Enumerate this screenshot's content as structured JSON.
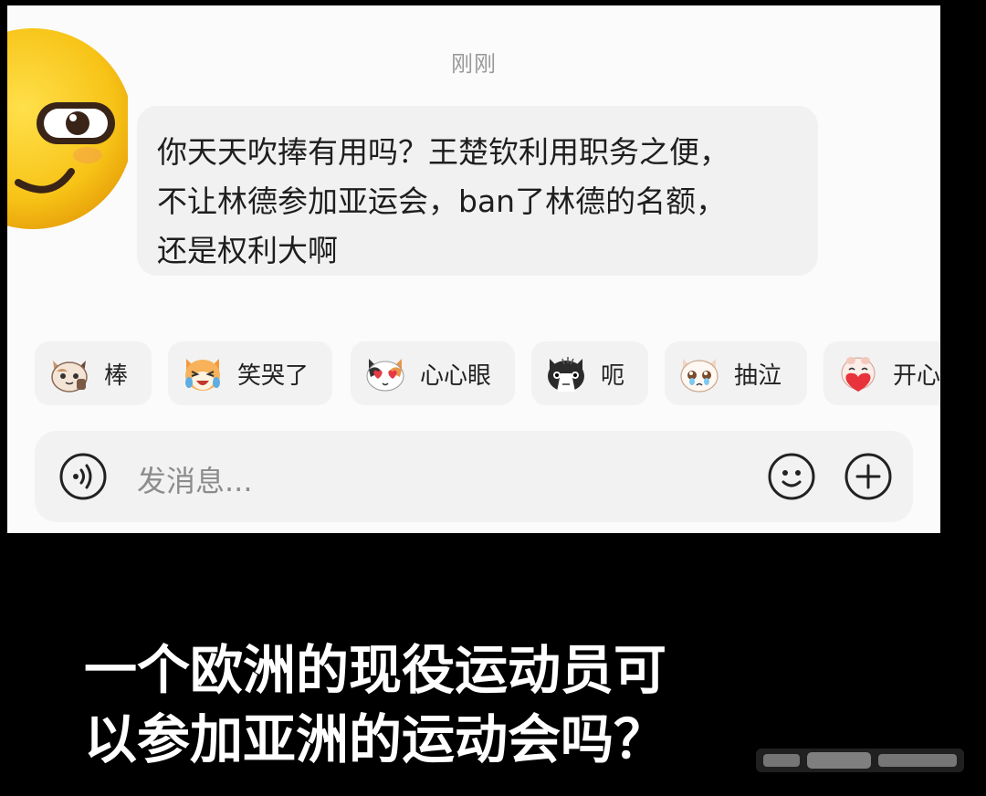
{
  "message": {
    "timestamp": "刚刚",
    "lines": [
      "你天天吹捧有用吗？王楚钦利用职务之便，",
      "不让林德参加亚运会，ban了林德的名额，",
      "还是权利大啊"
    ]
  },
  "quick_reactions": [
    {
      "label": "棒",
      "icon": "cat-thumbs-up-icon"
    },
    {
      "label": "笑哭了",
      "icon": "crying-laughing-dog-icon"
    },
    {
      "label": "心心眼",
      "icon": "heart-eyes-cat-icon"
    },
    {
      "label": "呃",
      "icon": "speechless-black-cat-icon"
    },
    {
      "label": "抽泣",
      "icon": "sobbing-cat-icon"
    },
    {
      "label": "开心",
      "icon": "happy-heart-creature-icon"
    }
  ],
  "composer": {
    "placeholder": "发消息...",
    "voice_icon": "voice-icon",
    "emoji_icon": "emoji-icon",
    "add_icon": "plus-icon"
  },
  "caption": {
    "lines": [
      "一个欧洲的现役运动员可",
      "以参加亚洲的运动会吗？"
    ]
  },
  "colors": {
    "screen_bg": "#fbfbfb",
    "bubble_bg": "#f1f1f2",
    "page_bg": "#000000",
    "caption_text": "#ffffff",
    "emoji_yellow": "#f8c61a"
  }
}
